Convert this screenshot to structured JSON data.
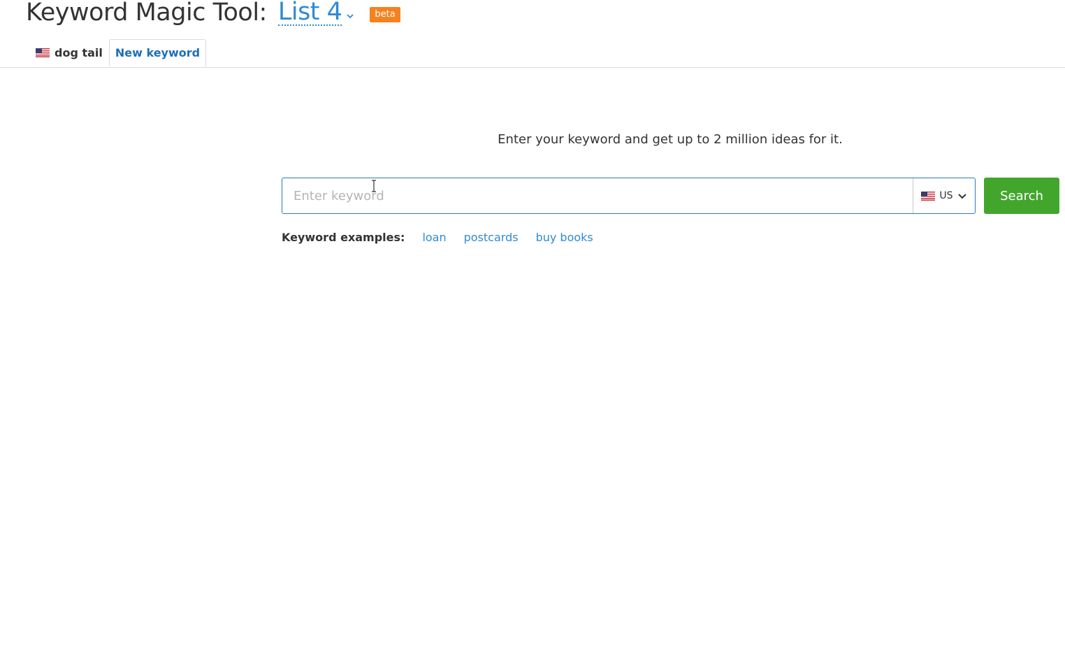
{
  "header": {
    "title": "Keyword Magic Tool:",
    "list_name": "List 4",
    "badge": "beta"
  },
  "tabs": [
    {
      "label": "dog tail",
      "flag": "us-flag-icon",
      "active": false
    },
    {
      "label": "New keyword",
      "active": true
    }
  ],
  "main": {
    "intro": "Enter your keyword and get up to 2 million ideas for it.",
    "search": {
      "placeholder": "Enter keyword",
      "value": "",
      "database": "US",
      "button_label": "Search"
    },
    "examples": {
      "label": "Keyword examples:",
      "items": [
        "loan",
        "postcards",
        "buy books"
      ]
    }
  },
  "colors": {
    "accent_link": "#2f8ad4",
    "search_button": "#43a62c",
    "beta_badge": "#f5821f",
    "active_tab_text": "#1e6fb5"
  }
}
